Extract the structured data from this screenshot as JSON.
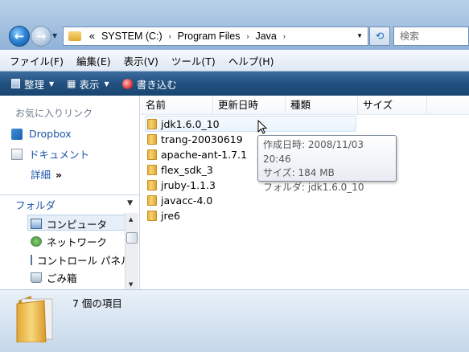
{
  "address": {
    "prefix": "«",
    "segments": [
      "SYSTEM (C:)",
      "Program Files",
      "Java"
    ],
    "separator": "›"
  },
  "search": {
    "placeholder": "検索"
  },
  "menu": [
    "ファイル(F)",
    "編集(E)",
    "表示(V)",
    "ツール(T)",
    "ヘルプ(H)"
  ],
  "commands": {
    "organize": "整理",
    "view": "表示",
    "burn": "書き込む"
  },
  "nav": {
    "favorites_title": "お気に入りリンク",
    "favorites": [
      "Dropbox",
      "ドキュメント"
    ],
    "more": "詳細",
    "more_arrows": "»",
    "folders_title": "フォルダ",
    "tree": [
      "コンピュータ",
      "ネットワーク",
      "コントロール パネル",
      "ごみ箱"
    ]
  },
  "columns": [
    "名前",
    "更新日時",
    "種類",
    "サイズ"
  ],
  "files": [
    "jdk1.6.0_10",
    "trang-20030619",
    "apache-ant-1.7.1",
    "flex_sdk_3",
    "jruby-1.1.3",
    "javacc-4.0",
    "jre6"
  ],
  "tooltip": {
    "line1": "作成日時: 2008/11/03 20:46",
    "line2": "サイズ: 184 MB",
    "line3": "フォルダ: jdk1.6.0_10"
  },
  "details": {
    "item_count": "7 個の項目"
  },
  "colors": {
    "accent": "#1c55a6",
    "toolbar": "#21507f",
    "folder": "#e9b53c"
  }
}
